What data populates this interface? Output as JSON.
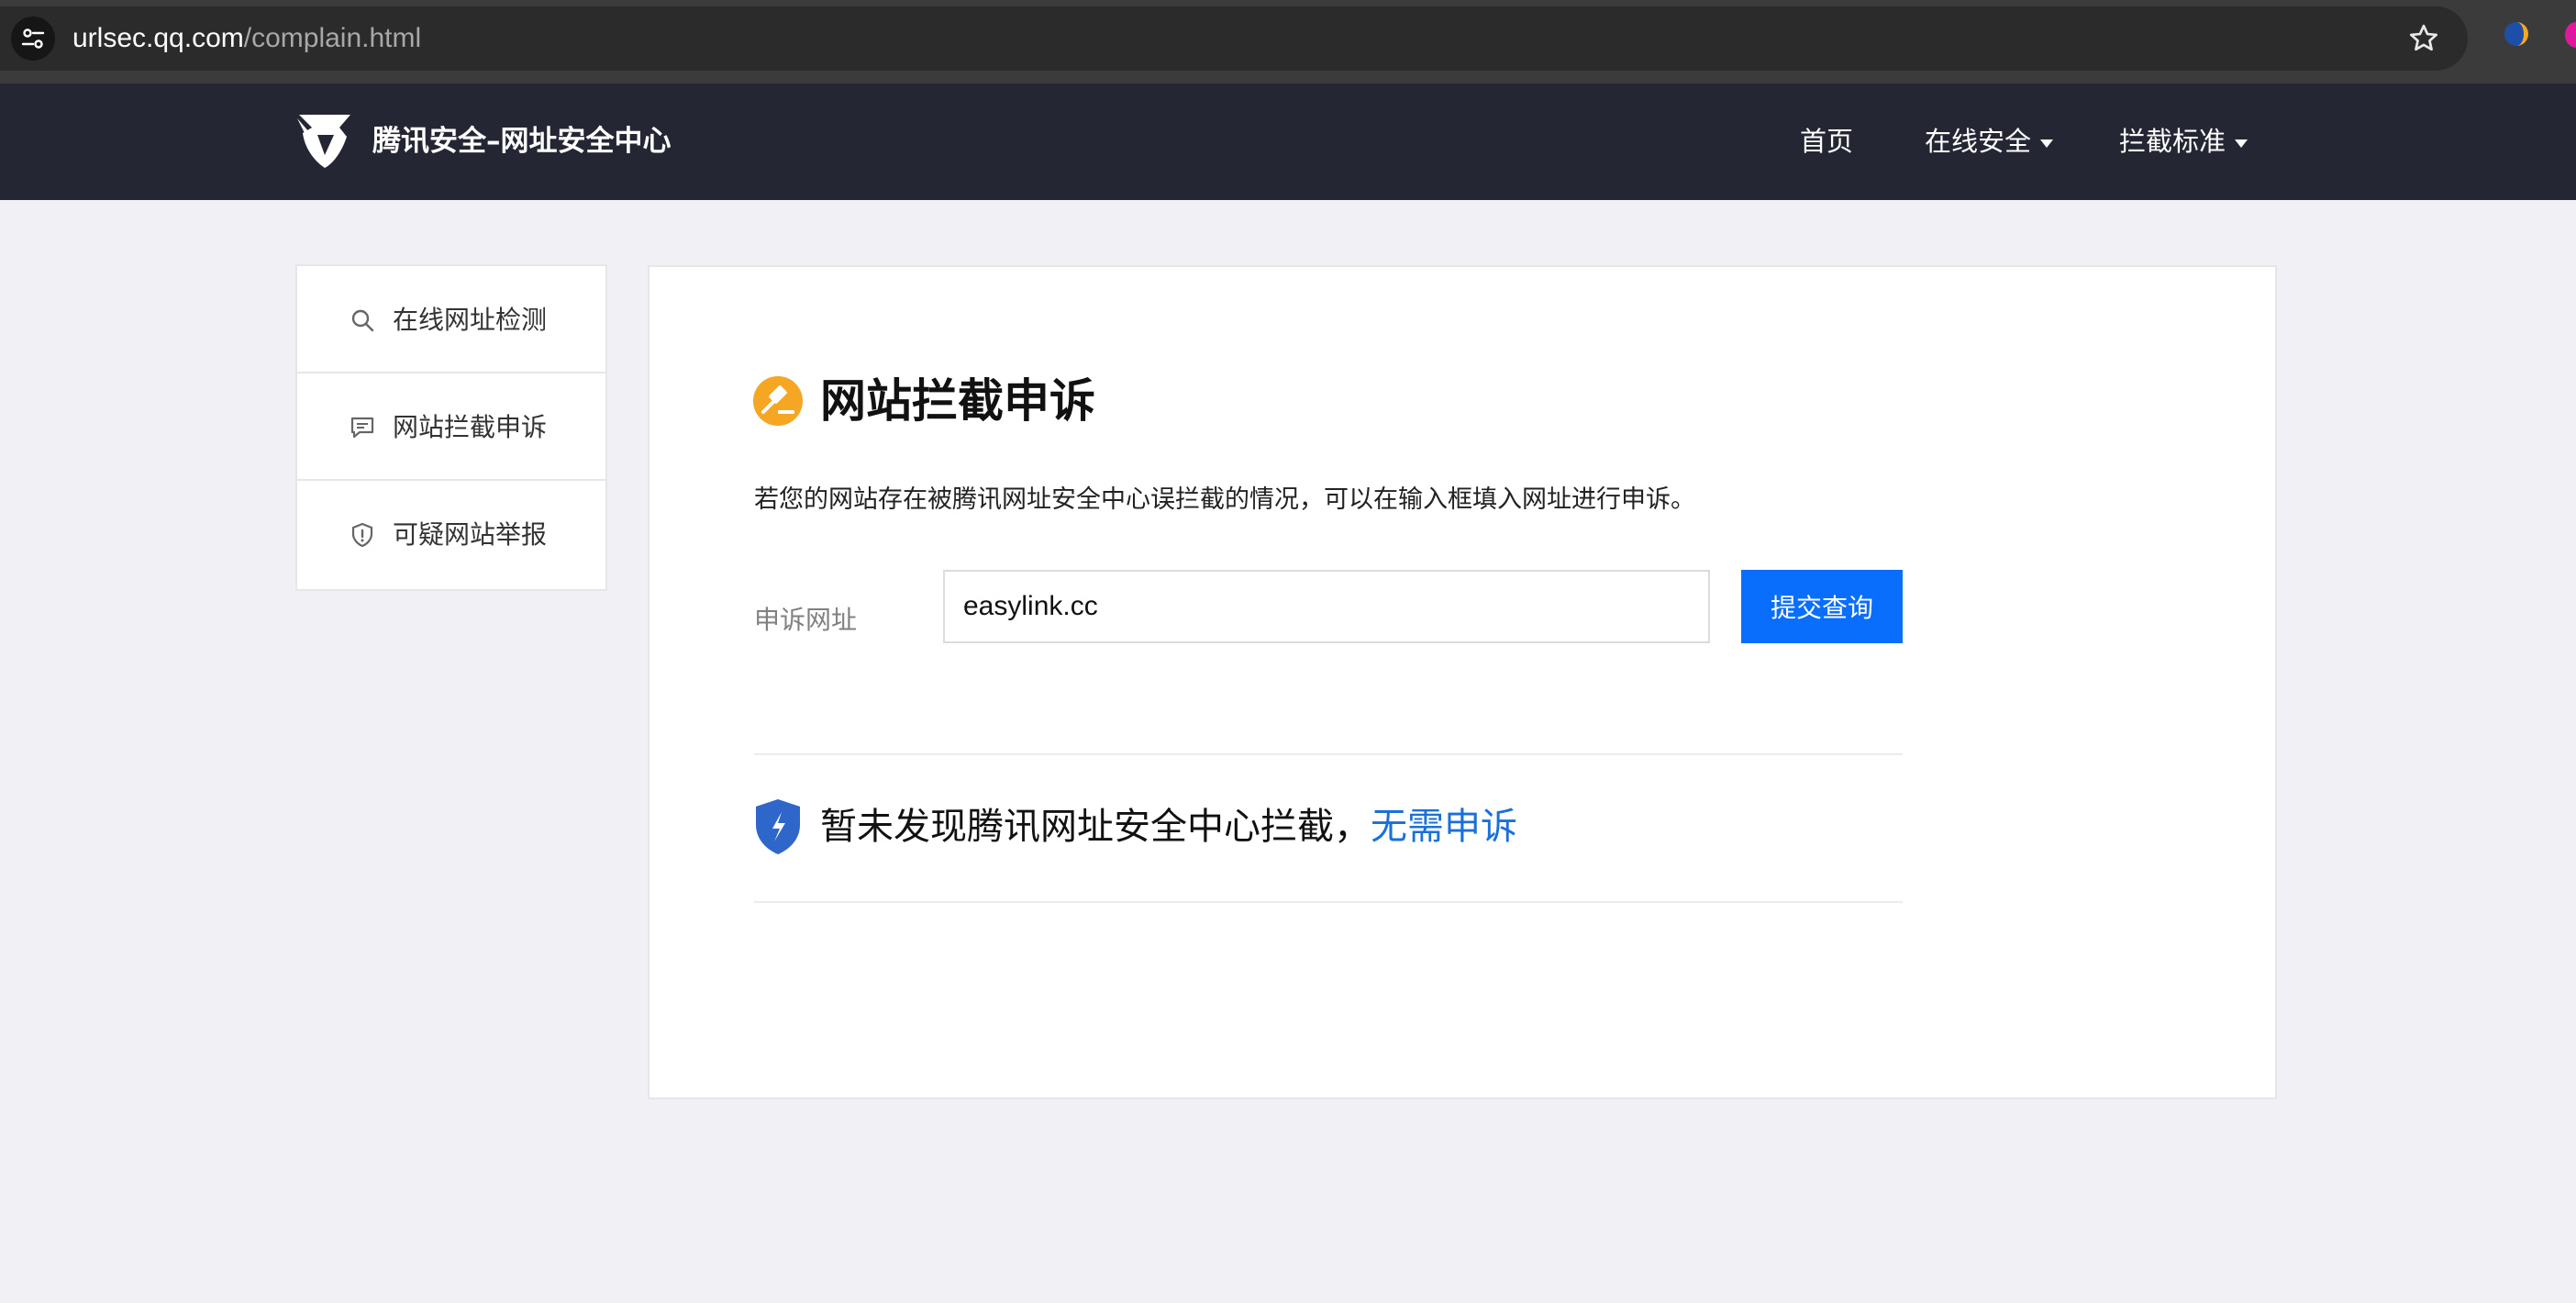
{
  "browser": {
    "url_host": "urlsec.qq.com",
    "url_path": "/complain.html"
  },
  "header": {
    "site_name": "腾讯安全–网址安全中心",
    "nav": [
      {
        "label": "首页",
        "has_caret": false
      },
      {
        "label": "在线安全",
        "has_caret": true
      },
      {
        "label": "拦截标准",
        "has_caret": true
      }
    ]
  },
  "sidebar": {
    "items": [
      {
        "label": "在线网址检测",
        "icon": "search-icon"
      },
      {
        "label": "网站拦截申诉",
        "icon": "comment-icon"
      },
      {
        "label": "可疑网站举报",
        "icon": "shield-alert-icon"
      }
    ]
  },
  "main": {
    "title": "网站拦截申诉",
    "description": "若您的网站存在被腾讯网址安全中心误拦截的情况，可以在输入框填入网址进行申诉。",
    "form": {
      "label": "申诉网址",
      "value": "easylink.cc",
      "submit_label": "提交查询"
    },
    "result": {
      "text": "暂未发现腾讯网址安全中心拦截，",
      "link_text": "无需申诉"
    }
  },
  "colors": {
    "header_bg": "#242633",
    "page_bg": "#f0f0f5",
    "primary": "#0a6efd",
    "link": "#1a6fd8",
    "title_icon": "#f5a623",
    "shield": "#2f66c9"
  }
}
